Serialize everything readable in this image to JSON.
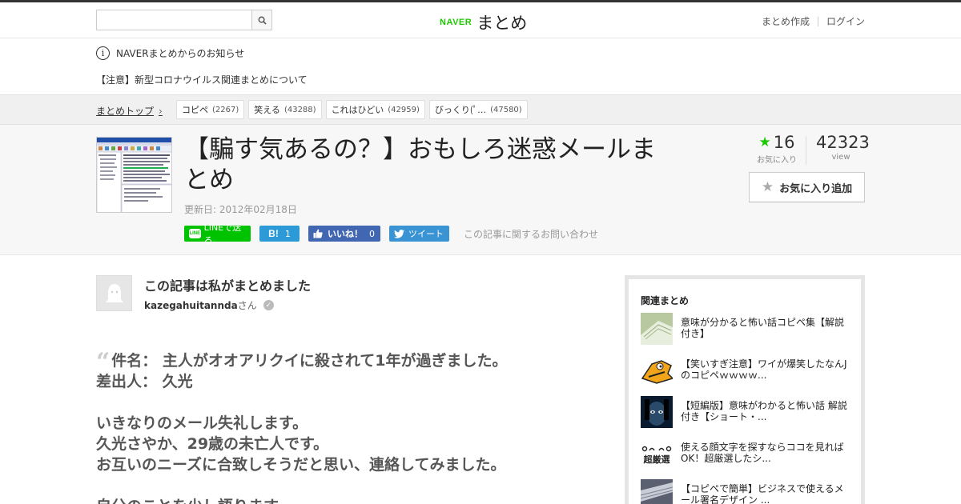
{
  "header": {
    "search_placeholder": "",
    "logo_naver": "NAVER",
    "logo_matome": "まとめ",
    "links": [
      "まとめ作成",
      "ログイン"
    ]
  },
  "notices": {
    "title": "NAVERまとめからのお知らせ",
    "item": "【注意】新型コロナウイルス関連まとめについて"
  },
  "breadcrumb": {
    "home": "まとめトップ",
    "tags": [
      {
        "label": "コピペ",
        "count": "(2267)"
      },
      {
        "label": "笑える",
        "count": "(43288)"
      },
      {
        "label": "これはひどい",
        "count": "(42959)"
      },
      {
        "label": "びっくり(ﾟ…",
        "count": "(47580)"
      }
    ]
  },
  "article": {
    "title": "【騙す気あるの？】おもしろ迷惑メールまとめ",
    "updated": "更新日: 2012年02月18日",
    "share": {
      "line": "LINEで送る",
      "line_badge": "LINE",
      "hatena": "B!",
      "hatena_count": "1",
      "facebook": "いいね！",
      "facebook_count": "0",
      "twitter": "ツイート"
    },
    "contact": "この記事に関するお問い合わせ",
    "favorites_count": "16",
    "favorites_label": "お気に入り",
    "views_count": "42323",
    "views_label": "view",
    "fav_button": "お気に入り追加"
  },
  "author": {
    "heading": "この記事は私がまとめました",
    "name": "kazegahuitannda",
    "suffix": "さん"
  },
  "quote": {
    "lines": [
      "件名： 主人がオオアリクイに殺されて1年が過ぎました。",
      "差出人： 久光",
      "",
      "いきなりのメール失礼します。",
      "久光さやか、29歳の未亡人です。",
      "お互いのニーズに合致しそうだと思い、連絡してみました。",
      "",
      "自分のことを少し語ります。"
    ]
  },
  "sidebar": {
    "title": "関連まとめ",
    "items": [
      {
        "title": "意味が分かると怖い話コピペ集【解説付き】"
      },
      {
        "title": "【笑いすぎ注意】ワイが爆笑したなんJのコピペｗｗｗｗ..."
      },
      {
        "title": "【短編版】意味がわかると怖い話 解説付き【ショート・..."
      },
      {
        "title": "使える顔文字を探すならココを見ればOK！超厳選したシ...",
        "thumb_text": "超厳選"
      },
      {
        "title": "【コピペで簡単】ビジネスで使えるメール署名デザイン ..."
      }
    ]
  },
  "colors": {
    "naver_green": "#1ec800",
    "line_green": "#00c300",
    "hatena_blue": "#2c9ad6",
    "facebook_blue": "#4267b2",
    "twitter_blue": "#3a93d3"
  }
}
